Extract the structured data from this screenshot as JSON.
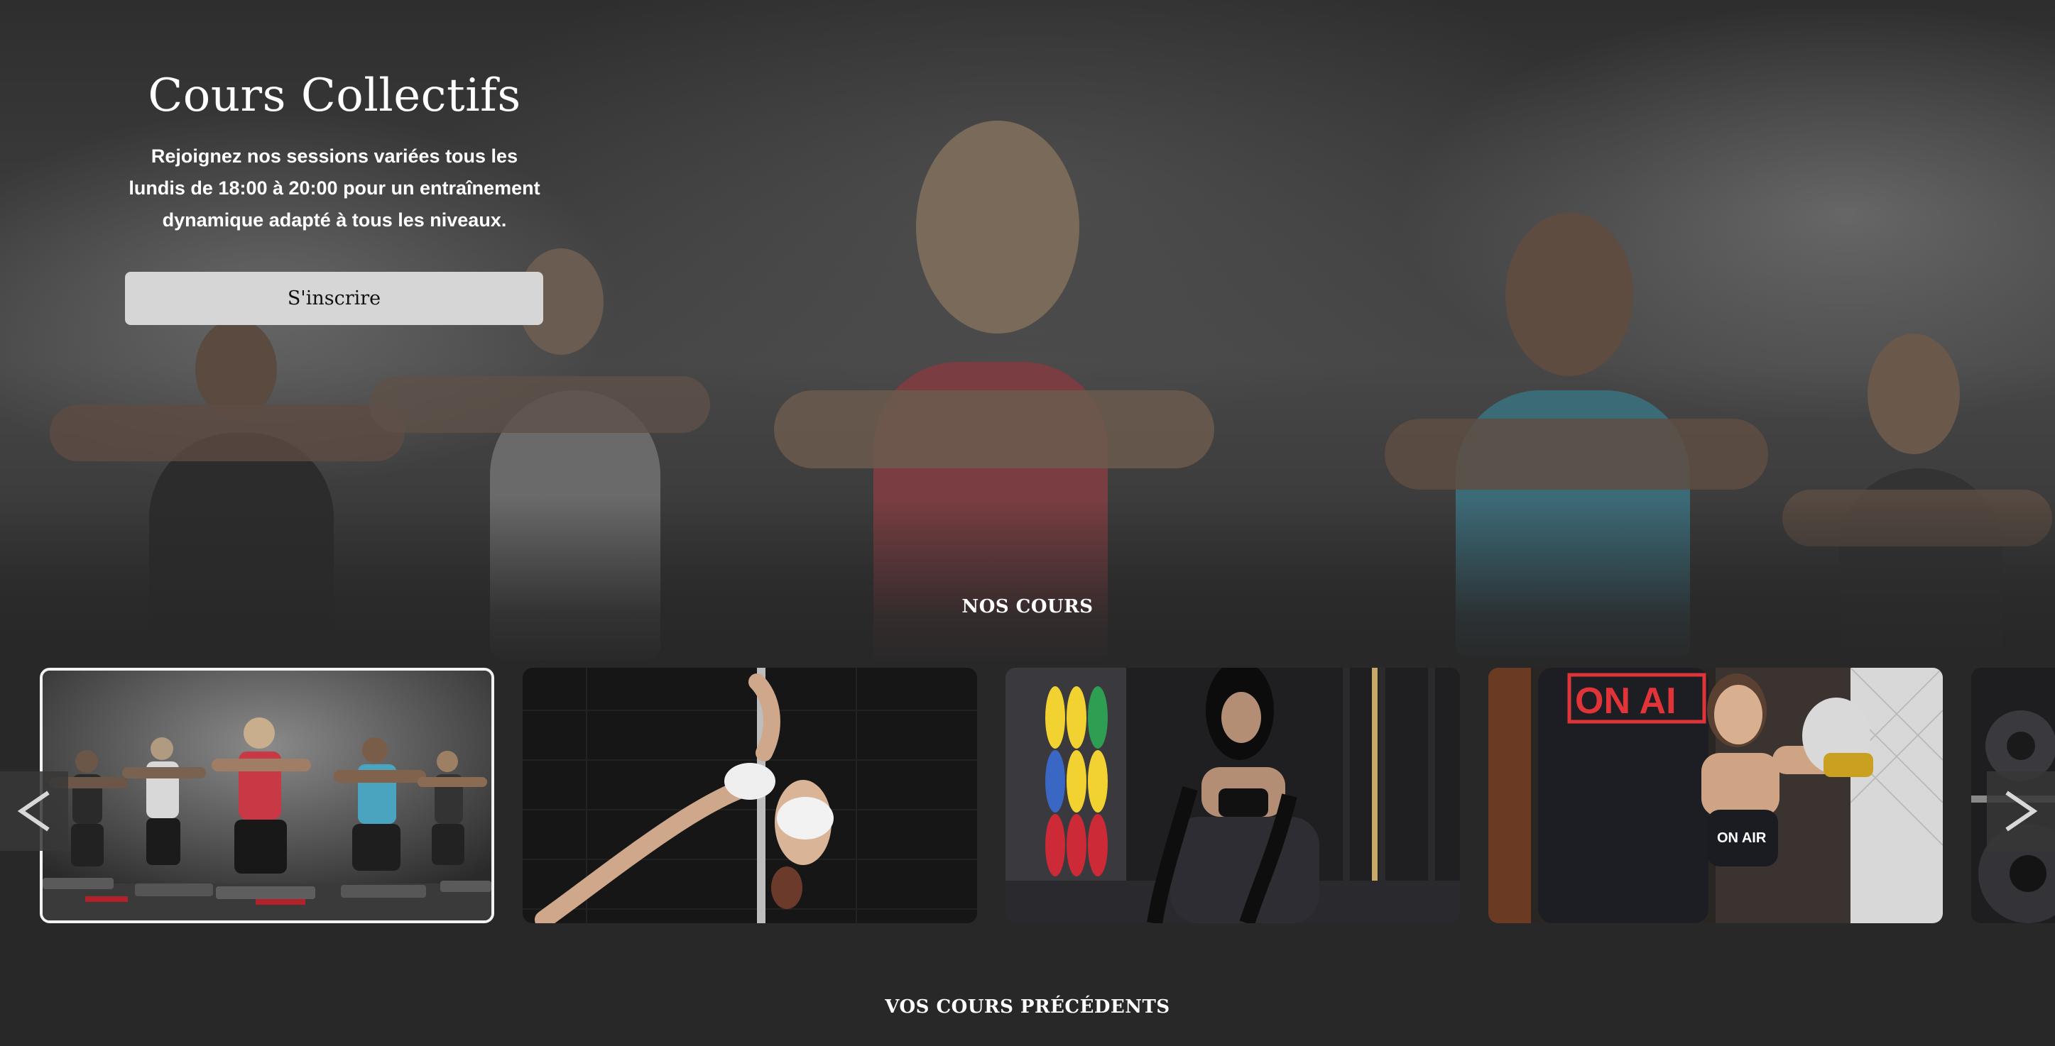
{
  "hero": {
    "title": "Cours Collectifs",
    "description": "Rejoignez nos sessions variées tous les lundis de 18:00 à 20:00 pour un entraînement dynamique adapté à tous les niveaux.",
    "button_label": "S'inscrire"
  },
  "courses_section": {
    "title": "NOS COURS",
    "cards": [
      {
        "label": "cours-collectif-photo",
        "active": true
      },
      {
        "label": "pole-dance-photo",
        "active": false
      },
      {
        "label": "battle-rope-photo",
        "active": false
      },
      {
        "label": "boxing-on-air-photo",
        "active": false
      },
      {
        "label": "weights-photo",
        "active": false
      }
    ],
    "prev_icon": "chevron-left-icon",
    "next_icon": "chevron-right-icon"
  },
  "previous_section": {
    "title": "VOS COURS PRÉCÉDENTS"
  },
  "colors": {
    "background": "#282828",
    "button": "#d6d6d6",
    "active_border": "#f2f2f2"
  }
}
